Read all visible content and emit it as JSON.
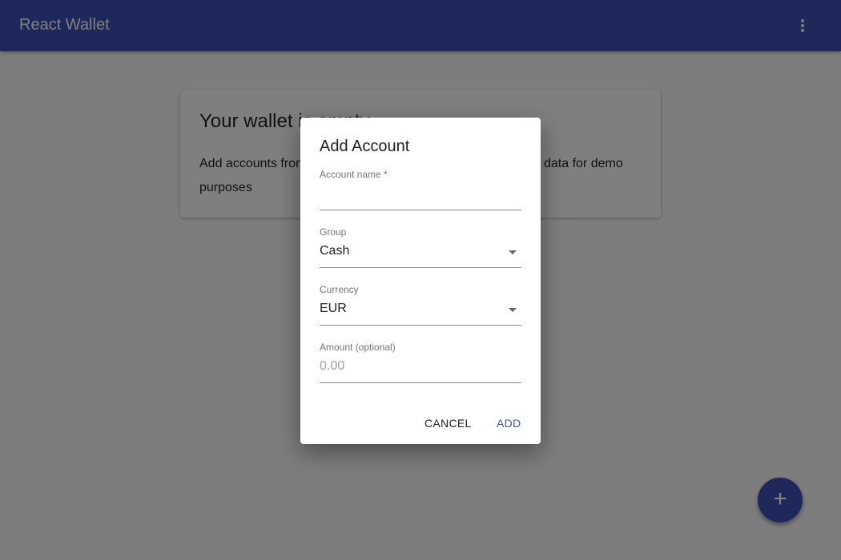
{
  "appbar": {
    "title": "React Wallet",
    "menu_icon": "more-vert-icon"
  },
  "card": {
    "title": "Your wallet is empty",
    "text_left": "Add accounts from",
    "text_right": "data for demo",
    "text_line2": "purposes"
  },
  "fab": {
    "label": "+"
  },
  "dialog": {
    "title": "Add Account",
    "fields": [
      {
        "label": "Account name *",
        "value": ""
      },
      {
        "label": "Group",
        "value": "Cash"
      },
      {
        "label": "Currency",
        "value": "EUR"
      },
      {
        "label": "Amount (optional)",
        "placeholder": "0.00"
      }
    ],
    "cancel": "CANCEL",
    "add": "ADD",
    "accent": "#3f51b5"
  }
}
